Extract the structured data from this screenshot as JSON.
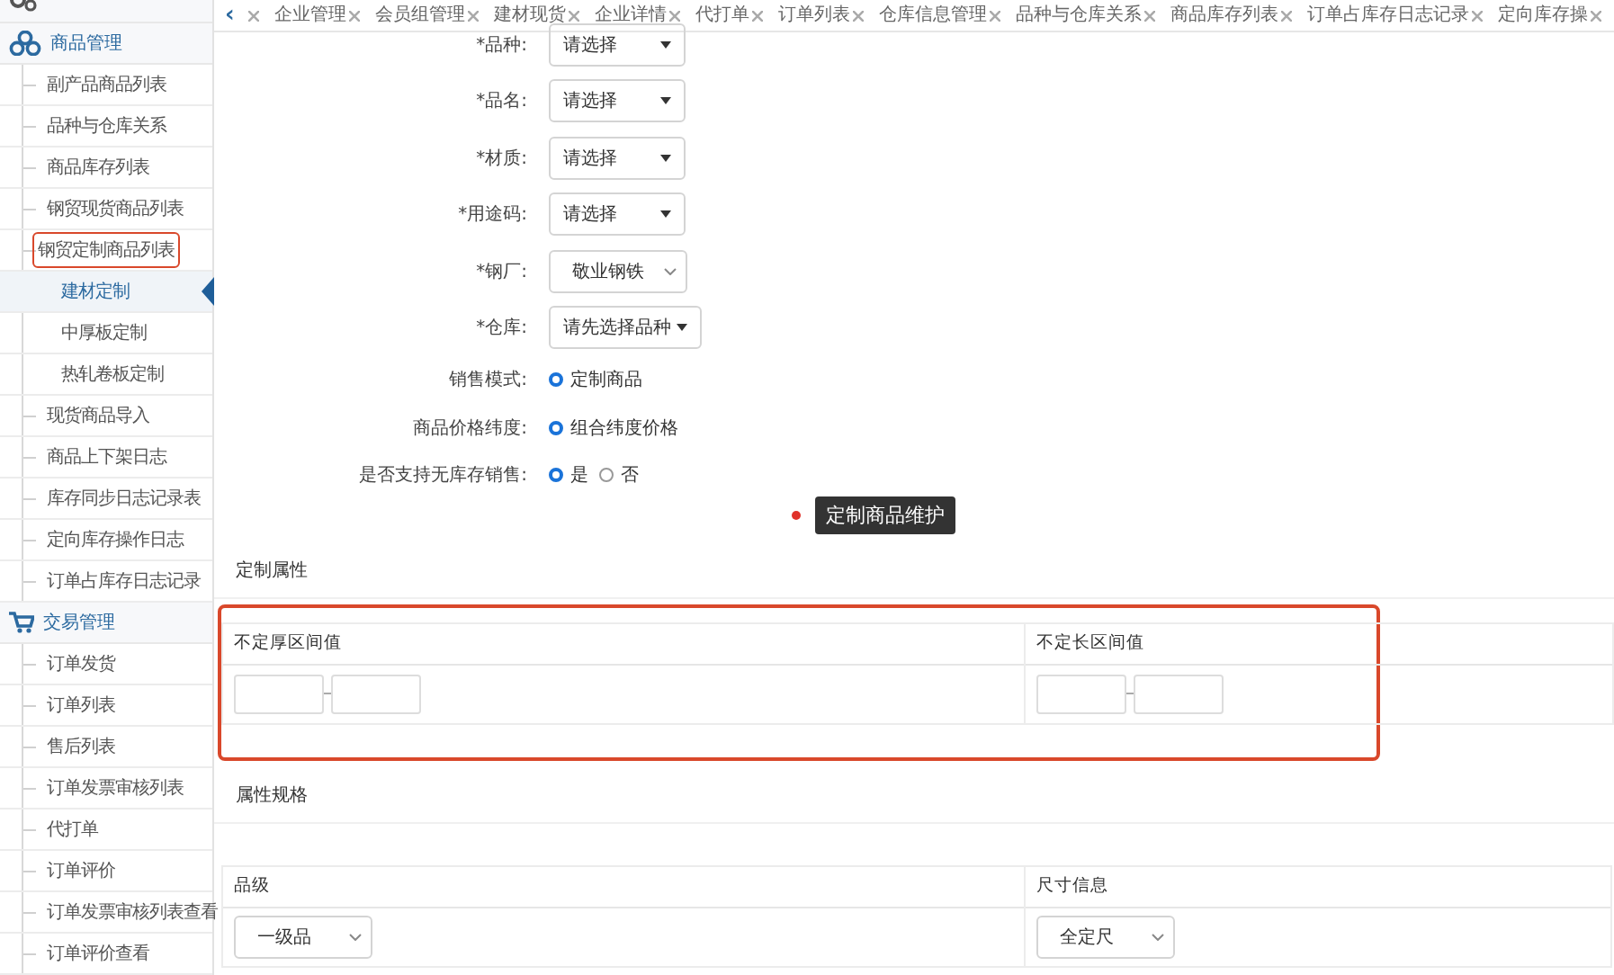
{
  "sidebar": {
    "groups": [
      {
        "kind": "gears"
      },
      {
        "kind": "cubes",
        "label": "商品管理",
        "items": [
          {
            "label": "副产品商品列表",
            "selected": false,
            "marked": false
          },
          {
            "label": "品种与仓库关系",
            "selected": false,
            "marked": false
          },
          {
            "label": "商品库存列表",
            "selected": false,
            "marked": false
          },
          {
            "label": "钢贸现货商品列表",
            "selected": false,
            "marked": false
          },
          {
            "label": "钢贸定制商品列表",
            "selected": false,
            "marked": true,
            "children": [
              {
                "label": "建材定制",
                "selected": true,
                "marked": false
              },
              {
                "label": "中厚板定制",
                "selected": false,
                "marked": false
              },
              {
                "label": "热轧卷板定制",
                "selected": false,
                "marked": false
              }
            ]
          },
          {
            "label": "现货商品导入",
            "selected": false,
            "marked": false
          },
          {
            "label": "商品上下架日志",
            "selected": false,
            "marked": false
          },
          {
            "label": "库存同步日志记录表",
            "selected": false,
            "marked": false
          },
          {
            "label": "定向库存操作日志",
            "selected": false,
            "marked": false
          },
          {
            "label": "订单占库存日志记录",
            "selected": false,
            "marked": false
          }
        ]
      },
      {
        "kind": "cart",
        "label": "交易管理",
        "items": [
          {
            "label": "订单发货",
            "selected": false,
            "marked": false
          },
          {
            "label": "订单列表",
            "selected": false,
            "marked": false
          },
          {
            "label": "售后列表",
            "selected": false,
            "marked": false
          },
          {
            "label": "订单发票审核列表",
            "selected": false,
            "marked": false
          },
          {
            "label": "代打单",
            "selected": false,
            "marked": false
          },
          {
            "label": "订单评价",
            "selected": false,
            "marked": false
          },
          {
            "label": "订单发票审核列表查看",
            "selected": false,
            "marked": false
          },
          {
            "label": "订单评价查看",
            "selected": false,
            "marked": false
          }
        ]
      }
    ]
  },
  "back": "‹",
  "tabs": [
    {
      "selected": false
    },
    {
      "label": "企业管理",
      "selected": false
    },
    {
      "label": "会员组管理",
      "selected": false
    },
    {
      "label": "建材现货",
      "selected": false
    },
    {
      "label": "企业详情",
      "selected": false
    },
    {
      "label": "代打单",
      "selected": false
    },
    {
      "label": "订单列表",
      "selected": false
    },
    {
      "label": "仓库信息管理",
      "selected": false
    },
    {
      "label": "品种与仓库关系",
      "selected": false
    },
    {
      "label": "商品库存列表",
      "selected": false
    },
    {
      "label": "订单占库存日志记录",
      "selected": false
    },
    {
      "label": "定向库存操",
      "selected": false
    }
  ],
  "form": [
    {
      "kind": "dropdown",
      "label": "*品种:",
      "value": "请选择"
    },
    {
      "kind": "dropdown",
      "label": "*品名:",
      "value": "请选择"
    },
    {
      "kind": "dropdown",
      "label": "*材质:",
      "value": "请选择"
    },
    {
      "kind": "dropdown",
      "label": "*用途码:",
      "value": "请选择"
    },
    {
      "kind": "select",
      "label": "*钢厂:",
      "value": "敬业钢铁"
    },
    {
      "kind": "dropdown",
      "label": "*仓库:",
      "value": "请先选择品种"
    },
    {
      "kind": "radio",
      "label": "销售模式:",
      "options": [
        {
          "label": "定制商品",
          "selected": true
        }
      ]
    },
    {
      "kind": "radio",
      "label": "商品价格纬度:",
      "options": [
        {
          "label": "组合纬度价格",
          "selected": true
        }
      ]
    },
    {
      "kind": "radio",
      "label": "是否支持无库存销售:",
      "options": [
        {
          "label": "是",
          "selected": true
        },
        {
          "label": "否",
          "selected": false
        }
      ]
    }
  ],
  "tooltip": "定制商品维护",
  "sections": [
    {
      "title": "定制属性",
      "marked": true,
      "columns": [
        {
          "header": "不定厚区间值",
          "kind": "range"
        },
        {
          "header": "不定长区间值",
          "kind": "range"
        }
      ]
    },
    {
      "title": "属性规格",
      "marked": false,
      "columns": [
        {
          "header": "品级",
          "kind": "select",
          "value": "一级品"
        },
        {
          "header": "尺寸信息",
          "kind": "select",
          "value": "全定尺"
        }
      ]
    }
  ]
}
